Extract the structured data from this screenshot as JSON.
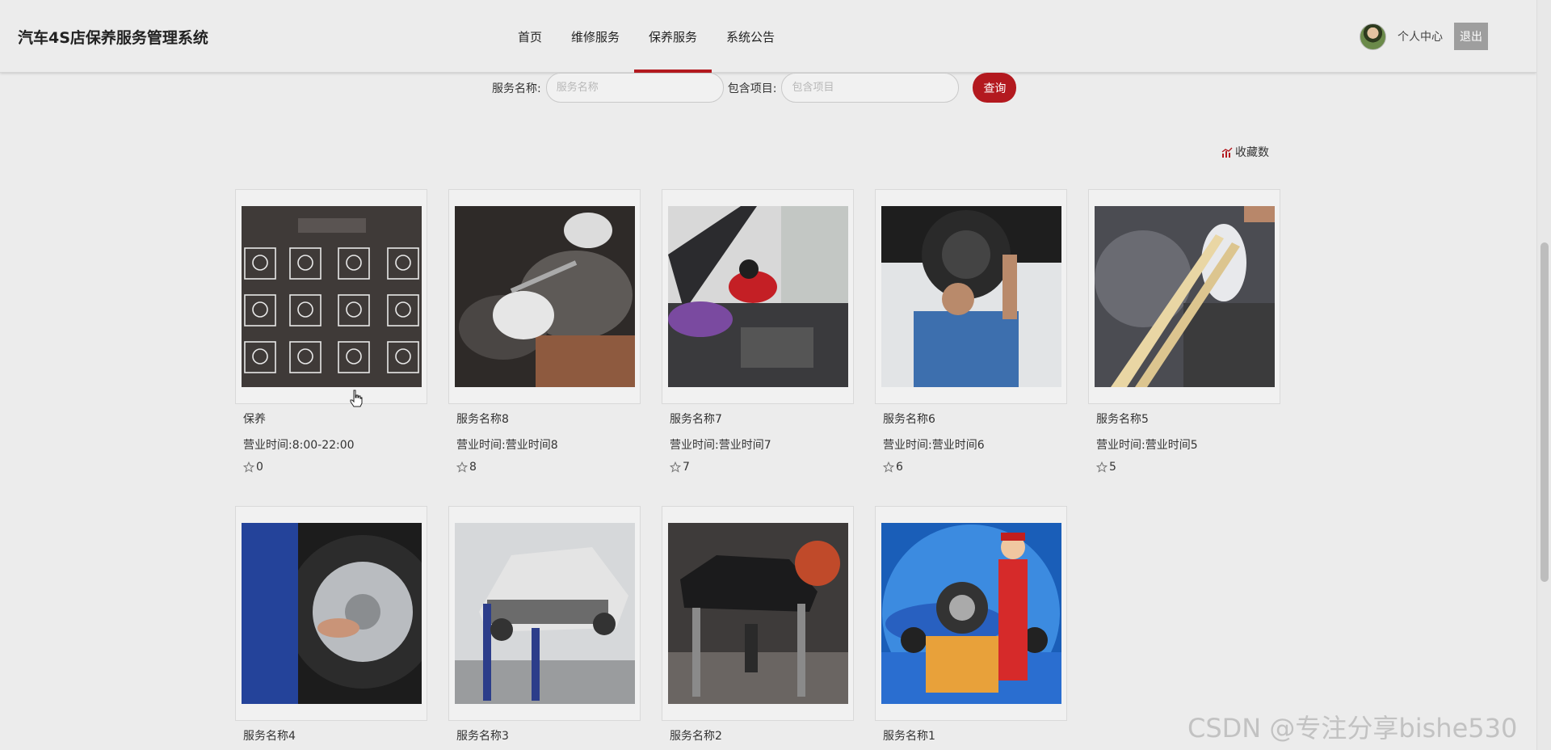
{
  "header": {
    "brand": "汽车4S店保养服务管理系统",
    "nav": [
      {
        "label": "首页",
        "active": false
      },
      {
        "label": "维修服务",
        "active": false
      },
      {
        "label": "保养服务",
        "active": true
      },
      {
        "label": "系统公告",
        "active": false
      }
    ],
    "user_center": "个人中心",
    "logout": "退出"
  },
  "search": {
    "name_label": "服务名称:",
    "name_placeholder": "服务名称",
    "items_label": "包含项目:",
    "items_placeholder": "包含项目",
    "button": "查询"
  },
  "sort": {
    "label": "收藏数"
  },
  "cards": [
    {
      "name": "保养",
      "hours": "营业时间:8:00-22:00",
      "fav": "0"
    },
    {
      "name": "服务名称8",
      "hours": "营业时间:营业时间8",
      "fav": "8"
    },
    {
      "name": "服务名称7",
      "hours": "营业时间:营业时间7",
      "fav": "7"
    },
    {
      "name": "服务名称6",
      "hours": "营业时间:营业时间6",
      "fav": "6"
    },
    {
      "name": "服务名称5",
      "hours": "营业时间:营业时间5",
      "fav": "5"
    },
    {
      "name": "服务名称4"
    },
    {
      "name": "服务名称3"
    },
    {
      "name": "服务名称2"
    },
    {
      "name": "服务名称1"
    }
  ],
  "watermark": "CSDN @专注分享bishe530",
  "colors": {
    "accent": "#b3191f",
    "background": "#ececec"
  }
}
